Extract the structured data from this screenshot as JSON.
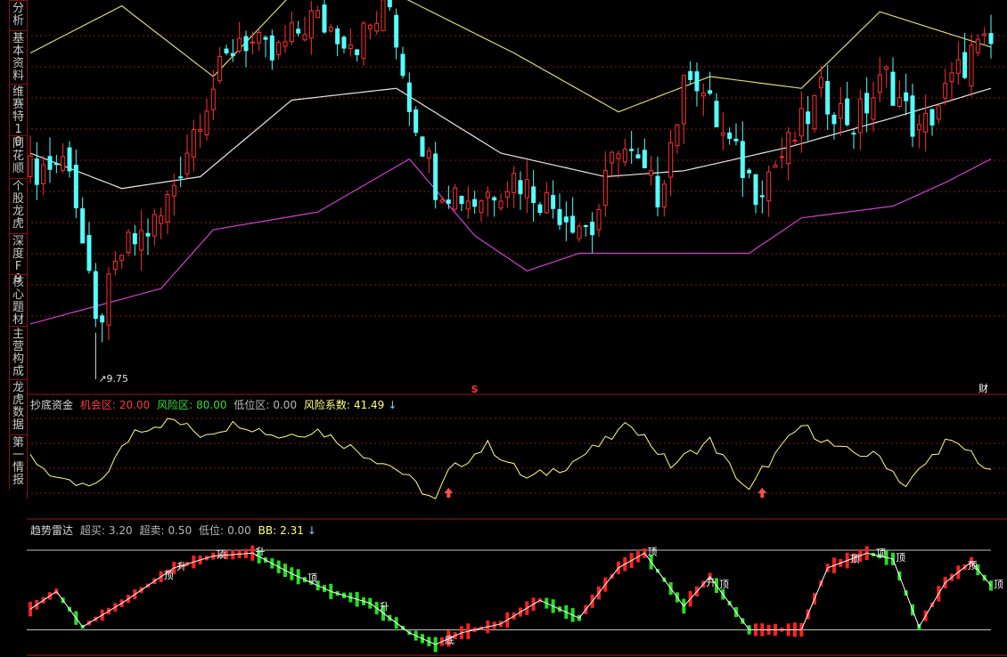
{
  "sidebar": {
    "tabs": [
      {
        "label": "分析"
      },
      {
        "label": "基本资料"
      },
      {
        "label": "维赛特10"
      },
      {
        "label": "同花顺"
      },
      {
        "label": "个股龙虎"
      },
      {
        "label": "深度F9"
      },
      {
        "label": "核心题材"
      },
      {
        "label": "主营构成"
      },
      {
        "label": "龙虎数据"
      },
      {
        "label": "第一情报"
      }
    ]
  },
  "colors": {
    "up": "#ff3030",
    "down": "#54ffff",
    "boll_upper": "#d8d870",
    "boll_mid": "#e8e8e8",
    "boll_lower": "#d040d0",
    "panel_border": "#a01818",
    "grid": "#8a1a1a",
    "osc_line": "#ffff80",
    "radar_up": "#ff2020",
    "radar_down": "#20e020",
    "radar_line": "#ffffff"
  },
  "price_panel": {
    "low_label": "9.75",
    "marker_s": "S",
    "marker_cai": "财"
  },
  "osc_panel": {
    "name": "抄底资金",
    "chance_label": "机会区:",
    "chance_value": "20.00",
    "risk_label": "风险区:",
    "risk_value": "80.00",
    "low_label": "低位区:",
    "low_value": "0.00",
    "coef_label": "风险系数:",
    "coef_value": "41.49"
  },
  "radar_panel": {
    "name": "趋势雷达",
    "overbuy_label": "超买:",
    "overbuy_value": "3.20",
    "oversell_label": "超卖:",
    "oversell_value": "0.50",
    "low_label": "低位:",
    "low_value": "0.00",
    "bb_label": "BB:",
    "bb_value": "2.31"
  },
  "chart_data": [
    {
      "type": "candlestick",
      "title": "",
      "ylim": [
        9.0,
        15.5
      ],
      "signals": [
        {
          "index": 68,
          "text": "S"
        },
        {
          "index": 147,
          "text": "财"
        }
      ],
      "ohlc_waypoints": [
        [
          0,
          12.6
        ],
        [
          6,
          12.8
        ],
        [
          10,
          9.9
        ],
        [
          14,
          11.2
        ],
        [
          20,
          11.8
        ],
        [
          26,
          13.6
        ],
        [
          32,
          14.9
        ],
        [
          37,
          14.5
        ],
        [
          43,
          15.2
        ],
        [
          50,
          14.8
        ],
        [
          55,
          15.4
        ],
        [
          58,
          13.8
        ],
        [
          62,
          12.4
        ],
        [
          68,
          12.1
        ],
        [
          74,
          12.5
        ],
        [
          80,
          12.0
        ],
        [
          86,
          11.6
        ],
        [
          90,
          13.1
        ],
        [
          96,
          12.2
        ],
        [
          101,
          14.4
        ],
        [
          106,
          13.2
        ],
        [
          111,
          12.3
        ],
        [
          116,
          13.0
        ],
        [
          121,
          13.9
        ],
        [
          126,
          13.4
        ],
        [
          131,
          14.2
        ],
        [
          136,
          13.2
        ],
        [
          141,
          14.1
        ],
        [
          144,
          14.6
        ],
        [
          147,
          14.7
        ]
      ],
      "bollinger": {
        "upper": [
          [
            0,
            14.6
          ],
          [
            14,
            15.4
          ],
          [
            28,
            14.2
          ],
          [
            40,
            15.6
          ],
          [
            56,
            15.6
          ],
          [
            74,
            14.6
          ],
          [
            90,
            13.6
          ],
          [
            104,
            14.2
          ],
          [
            118,
            14.0
          ],
          [
            130,
            15.3
          ],
          [
            147,
            14.7
          ]
        ],
        "mid": [
          [
            0,
            12.9
          ],
          [
            14,
            12.3
          ],
          [
            26,
            12.5
          ],
          [
            40,
            13.8
          ],
          [
            56,
            14.0
          ],
          [
            72,
            12.9
          ],
          [
            88,
            12.5
          ],
          [
            100,
            12.6
          ],
          [
            116,
            13.0
          ],
          [
            132,
            13.5
          ],
          [
            147,
            14.0
          ]
        ],
        "lower": [
          [
            0,
            10.0
          ],
          [
            20,
            10.6
          ],
          [
            28,
            11.6
          ],
          [
            44,
            11.9
          ],
          [
            58,
            12.8
          ],
          [
            68,
            11.5
          ],
          [
            76,
            10.9
          ],
          [
            84,
            11.2
          ],
          [
            92,
            11.2
          ],
          [
            100,
            11.2
          ],
          [
            110,
            11.2
          ],
          [
            118,
            11.8
          ],
          [
            132,
            12.0
          ],
          [
            140,
            12.4
          ],
          [
            147,
            12.8
          ]
        ]
      }
    },
    {
      "type": "line",
      "title": "",
      "series": [
        {
          "values_waypoints": [
            [
              0,
              55
            ],
            [
              5,
              25
            ],
            [
              10,
              20
            ],
            [
              16,
              85
            ],
            [
              22,
              96
            ],
            [
              26,
              80
            ],
            [
              32,
              93
            ],
            [
              38,
              78
            ],
            [
              44,
              85
            ],
            [
              50,
              62
            ],
            [
              56,
              42
            ],
            [
              62,
              5
            ],
            [
              64,
              38
            ],
            [
              70,
              68
            ],
            [
              76,
              30
            ],
            [
              82,
              45
            ],
            [
              88,
              72
            ],
            [
              92,
              93
            ],
            [
              98,
              45
            ],
            [
              104,
              73
            ],
            [
              110,
              15
            ],
            [
              112,
              40
            ],
            [
              118,
              90
            ],
            [
              124,
              62
            ],
            [
              130,
              55
            ],
            [
              134,
              22
            ],
            [
              140,
              72
            ],
            [
              144,
              60
            ],
            [
              147,
              35
            ]
          ]
        }
      ],
      "reference_lines": [
        20,
        80
      ],
      "signals": [
        {
          "index": 64,
          "marker": "arrow-up"
        },
        {
          "index": 112,
          "marker": "arrow-up"
        }
      ]
    },
    {
      "type": "bar",
      "title": "",
      "ylim": [
        0,
        3.2
      ],
      "reference_lines": [
        0.5,
        3.2
      ],
      "values_waypoints": [
        [
          0,
          1.2
        ],
        [
          4,
          1.8
        ],
        [
          8,
          0.6
        ],
        [
          14,
          1.4
        ],
        [
          22,
          2.6
        ],
        [
          28,
          3.0
        ],
        [
          34,
          3.1
        ],
        [
          40,
          2.4
        ],
        [
          46,
          1.8
        ],
        [
          52,
          1.4
        ],
        [
          58,
          0.4
        ],
        [
          62,
          0.0
        ],
        [
          66,
          0.4
        ],
        [
          72,
          0.7
        ],
        [
          78,
          1.5
        ],
        [
          84,
          0.9
        ],
        [
          90,
          2.6
        ],
        [
          94,
          3.1
        ],
        [
          100,
          1.3
        ],
        [
          104,
          2.3
        ],
        [
          110,
          0.5
        ],
        [
          118,
          0.5
        ],
        [
          122,
          2.6
        ],
        [
          128,
          3.1
        ],
        [
          132,
          2.9
        ],
        [
          136,
          0.6
        ],
        [
          140,
          2.1
        ],
        [
          144,
          2.8
        ],
        [
          147,
          2.0
        ]
      ],
      "labels": [
        {
          "index": 20,
          "text": "顶"
        },
        {
          "index": 22,
          "text": "升"
        },
        {
          "index": 28,
          "text": "顶"
        },
        {
          "index": 34,
          "text": "升"
        },
        {
          "index": 42,
          "text": "顶"
        },
        {
          "index": 53,
          "text": "升"
        },
        {
          "index": 63,
          "text": "底"
        },
        {
          "index": 94,
          "text": "顶"
        },
        {
          "index": 103,
          "text": "升"
        },
        {
          "index": 105,
          "text": "顶"
        },
        {
          "index": 125,
          "text": "顶"
        },
        {
          "index": 129,
          "text": "顶"
        },
        {
          "index": 132,
          "text": "顶"
        },
        {
          "index": 143,
          "text": "顶"
        },
        {
          "index": 147,
          "text": "顶"
        }
      ]
    }
  ]
}
